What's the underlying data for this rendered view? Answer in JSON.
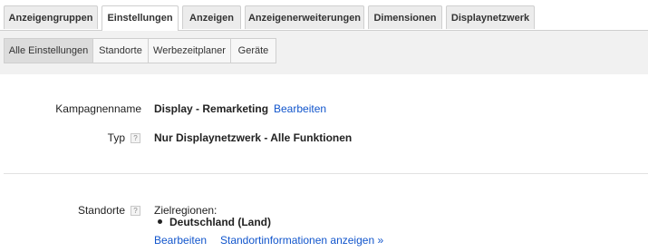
{
  "main_tabs": [
    {
      "label": "Anzeigengruppen",
      "active": false
    },
    {
      "label": "Einstellungen",
      "active": true
    },
    {
      "label": "Anzeigen",
      "active": false
    },
    {
      "label": "Anzeigenerweiterungen",
      "active": false
    },
    {
      "label": "Dimensionen",
      "active": false
    },
    {
      "label": "Displaynetzwerk",
      "active": false
    }
  ],
  "sub_tabs": [
    {
      "label": "Alle Einstellungen",
      "active": true
    },
    {
      "label": "Standorte",
      "active": false
    },
    {
      "label": "Werbezeitplaner",
      "active": false
    },
    {
      "label": "Geräte",
      "active": false
    }
  ],
  "settings": {
    "campaign_name": {
      "label": "Kampagnenname",
      "value": "Display - Remarketing",
      "edit_link": "Bearbeiten"
    },
    "type": {
      "label": "Typ",
      "help": "?",
      "value": "Nur Displaynetzwerk - Alle Funktionen"
    },
    "locations": {
      "label": "Standorte",
      "help": "?",
      "heading": "Zielregionen:",
      "items": [
        "Deutschland (Land)"
      ],
      "edit_link": "Bearbeiten",
      "info_link": "Standortinformationen anzeigen »"
    }
  },
  "colors": {
    "link": "#1155cc",
    "tab_border": "#cfcfcf",
    "subtab_bar": "#f1f1f1"
  }
}
